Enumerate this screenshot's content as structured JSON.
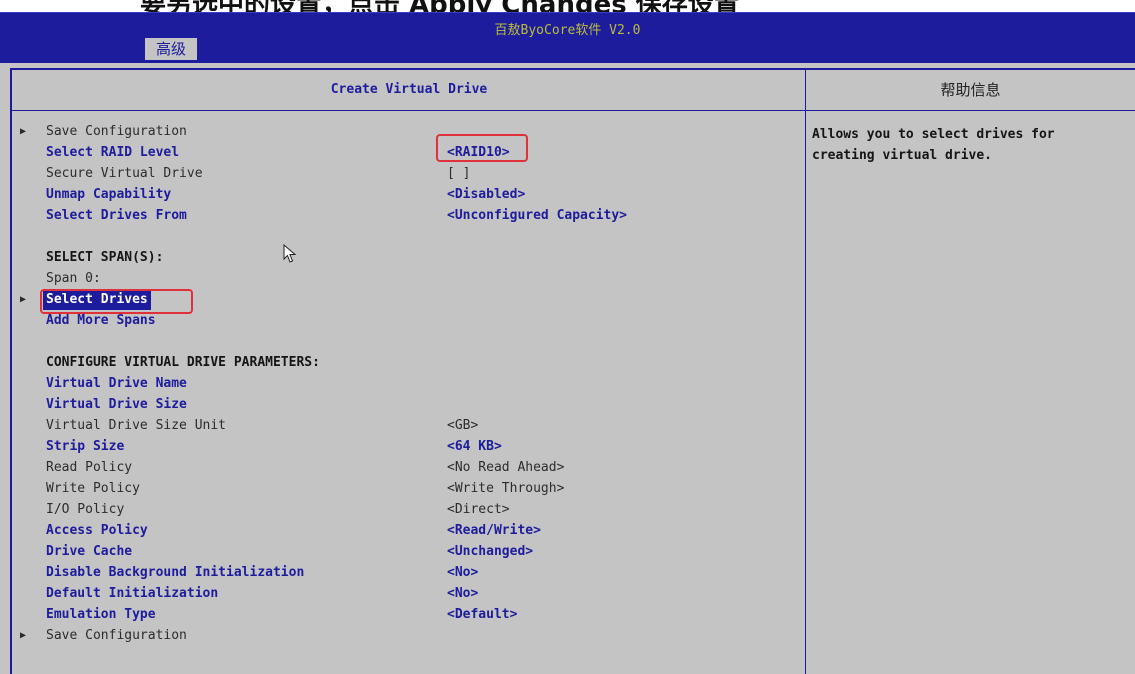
{
  "page_header": "要另选中的设置，点击 Apply Changes 保存设置",
  "app_title": "百敖ByoCore软件 V2.0",
  "tab": "高级",
  "main_header": "Create Virtual Drive",
  "help": {
    "title": "帮助信息",
    "text": "Allows you to select drives for creating virtual drive."
  },
  "rows": [
    {
      "label": "Save Configuration",
      "value": "",
      "arrow": true,
      "style": "grey"
    },
    {
      "label": "Select RAID Level",
      "value": "<RAID10>",
      "arrow": false,
      "style": "blue"
    },
    {
      "label": "Secure Virtual Drive",
      "value": "[ ]",
      "arrow": false,
      "style": "grey"
    },
    {
      "label": "Unmap Capability",
      "value": "<Disabled>",
      "arrow": false,
      "style": "blue"
    },
    {
      "label": "Select Drives From",
      "value": "<Unconfigured Capacity>",
      "arrow": false,
      "style": "blue"
    },
    {
      "label": "",
      "value": "",
      "arrow": false,
      "style": "grey"
    },
    {
      "label": "SELECT SPAN(S):",
      "value": "",
      "arrow": false,
      "style": "section"
    },
    {
      "label": "Span 0:",
      "value": "",
      "arrow": false,
      "style": "grey"
    },
    {
      "label": "Select Drives",
      "value": "",
      "arrow": true,
      "style": "blue",
      "selected": true
    },
    {
      "label": "Add More Spans",
      "value": "",
      "arrow": false,
      "style": "blue"
    },
    {
      "label": "",
      "value": "",
      "arrow": false,
      "style": "grey"
    },
    {
      "label": "CONFIGURE VIRTUAL DRIVE PARAMETERS:",
      "value": "",
      "arrow": false,
      "style": "section"
    },
    {
      "label": "Virtual Drive Name",
      "value": "",
      "arrow": false,
      "style": "blue"
    },
    {
      "label": "Virtual Drive Size",
      "value": "",
      "arrow": false,
      "style": "blue"
    },
    {
      "label": "Virtual Drive Size Unit",
      "value": "<GB>",
      "arrow": false,
      "style": "grey"
    },
    {
      "label": "Strip Size",
      "value": "<64 KB>",
      "arrow": false,
      "style": "blue"
    },
    {
      "label": "Read Policy",
      "value": "<No Read Ahead>",
      "arrow": false,
      "style": "grey"
    },
    {
      "label": "Write Policy",
      "value": "<Write Through>",
      "arrow": false,
      "style": "grey"
    },
    {
      "label": "I/O Policy",
      "value": "<Direct>",
      "arrow": false,
      "style": "grey"
    },
    {
      "label": "Access Policy",
      "value": "<Read/Write>",
      "arrow": false,
      "style": "blue"
    },
    {
      "label": "Drive Cache",
      "value": "<Unchanged>",
      "arrow": false,
      "style": "blue"
    },
    {
      "label": "Disable Background Initialization",
      "value": "<No>",
      "arrow": false,
      "style": "blue"
    },
    {
      "label": "Default Initialization",
      "value": "<No>",
      "arrow": false,
      "style": "blue"
    },
    {
      "label": "Emulation Type",
      "value": "<Default>",
      "arrow": false,
      "style": "blue"
    },
    {
      "label": "Save Configuration",
      "value": "",
      "arrow": true,
      "style": "grey"
    }
  ]
}
